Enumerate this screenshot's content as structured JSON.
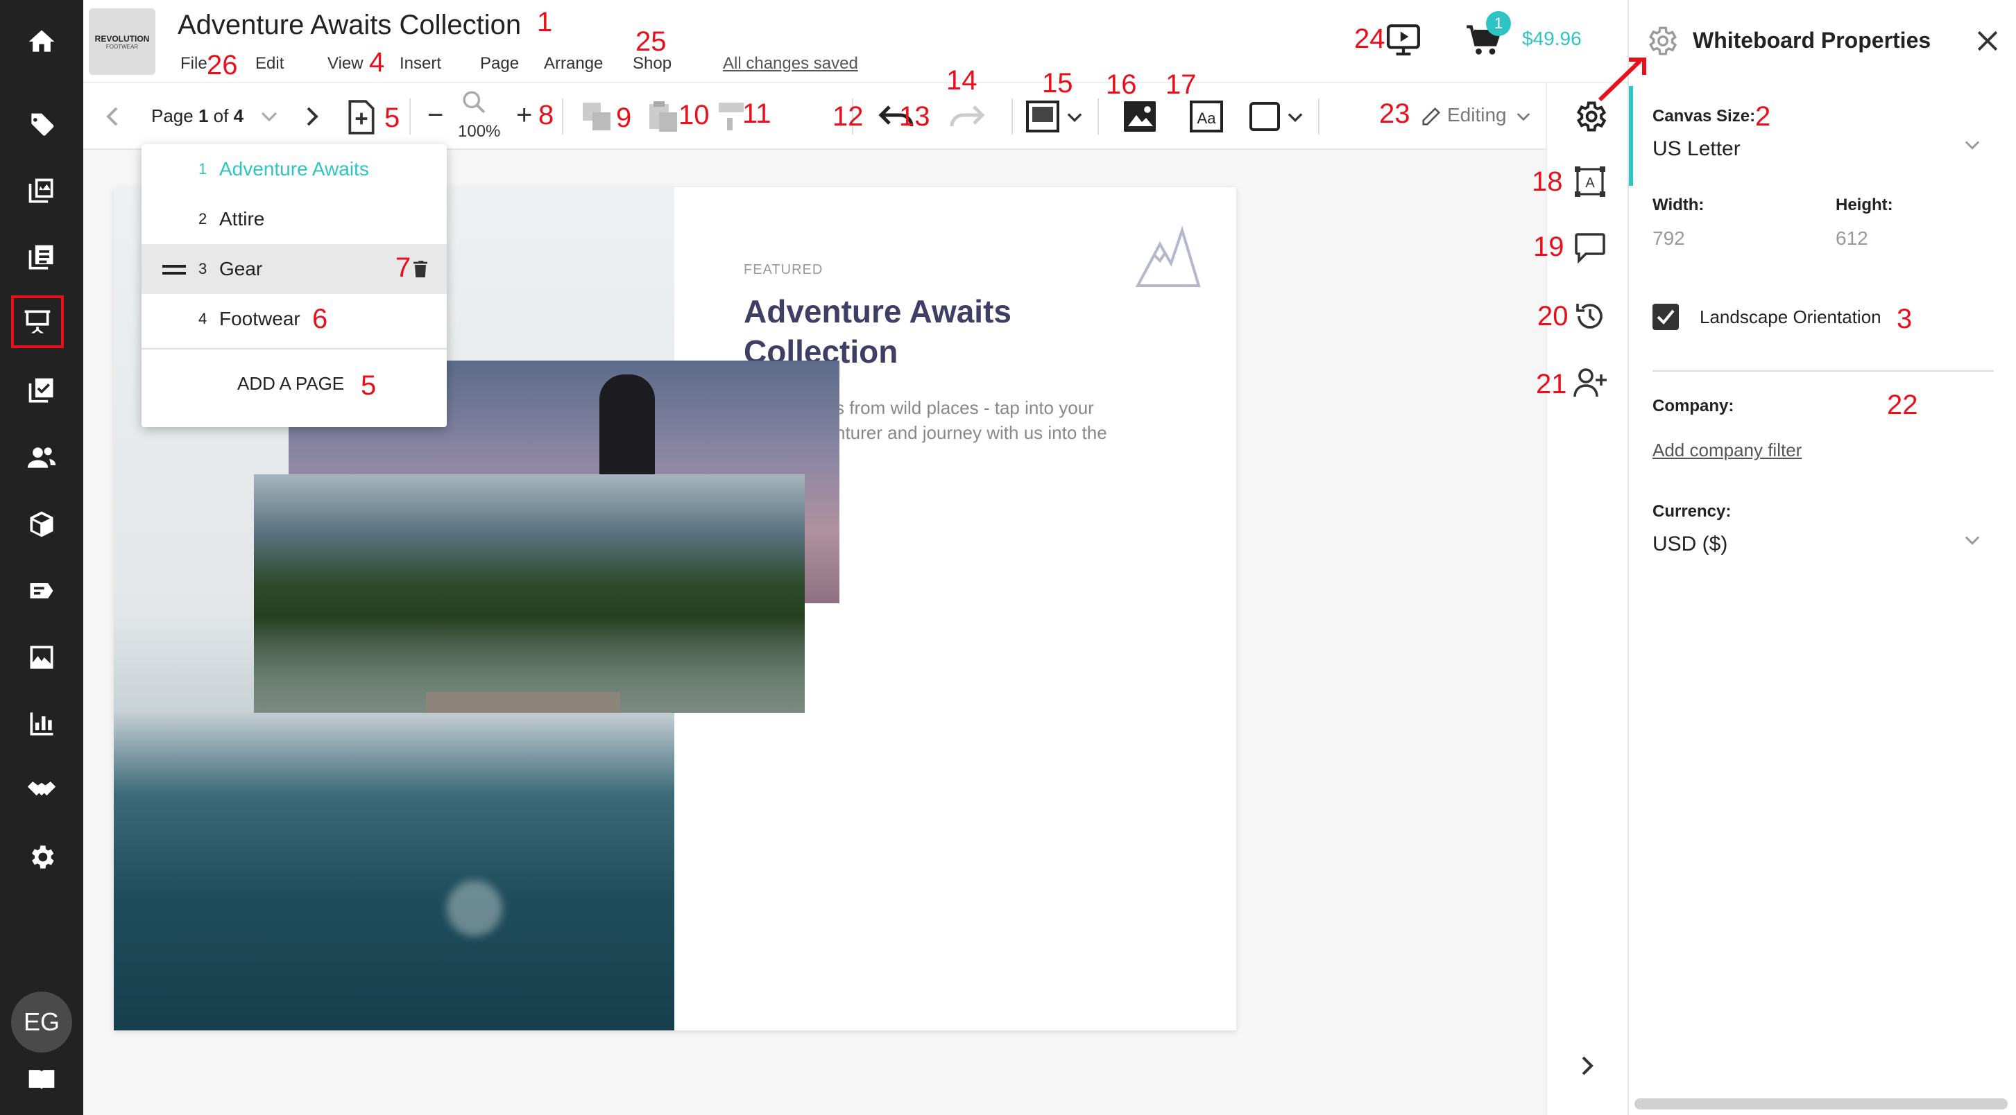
{
  "header": {
    "title": "Adventure Awaits Collection",
    "logo_text": "REVOLUTION",
    "logo_sub": "FOOTWEAR",
    "menu": [
      "File",
      "Edit",
      "View",
      "Insert",
      "Page",
      "Arrange",
      "Shop"
    ],
    "save_status": "All changes saved",
    "cart_count": "1",
    "cart_total": "$49.96"
  },
  "toolbar": {
    "page_label": "Page",
    "page_current": "1",
    "page_of": "of",
    "page_total": "4",
    "zoom": "100%",
    "minus": "−",
    "plus": "+",
    "mode": "Editing"
  },
  "pages_dropdown": {
    "items": [
      {
        "num": "1",
        "label": "Adventure Awaits"
      },
      {
        "num": "2",
        "label": "Attire"
      },
      {
        "num": "3",
        "label": "Gear"
      },
      {
        "num": "4",
        "label": "Footwear"
      }
    ],
    "add_label": "ADD A PAGE"
  },
  "canvas": {
    "eyebrow": "FEATURED",
    "title_line1": "Adventure Awaits",
    "title_line2": "Collection",
    "body_line1": "s from wild places - tap into your",
    "body_line2": "nturer and journey with us into the"
  },
  "panel": {
    "title": "Whiteboard Properties",
    "canvas_size_label": "Canvas Size:",
    "canvas_size_value": "US Letter",
    "width_label": "Width:",
    "width_value": "792",
    "height_label": "Height:",
    "height_value": "612",
    "landscape_label": "Landscape Orientation",
    "company_label": "Company:",
    "company_link": "Add company filter",
    "currency_label": "Currency:",
    "currency_value": "USD ($)"
  },
  "user": {
    "initials": "EG"
  },
  "markers": {
    "m1": "1",
    "m2": "2",
    "m3": "3",
    "m4": "4",
    "m5a": "5",
    "m5b": "5",
    "m6": "6",
    "m7": "7",
    "m8": "8",
    "m9": "9",
    "m10": "10",
    "m11": "11",
    "m12": "12",
    "m13": "13",
    "m14": "14",
    "m15": "15",
    "m16": "16",
    "m17": "17",
    "m18": "18",
    "m19": "19",
    "m20": "20",
    "m21": "21",
    "m22": "22",
    "m23": "23",
    "m24": "24",
    "m25": "25",
    "m26": "26"
  },
  "colors": {
    "accent": "#2ec4c4",
    "rail": "#222222",
    "marker": "#e8101a",
    "title": "#3f3f66"
  }
}
